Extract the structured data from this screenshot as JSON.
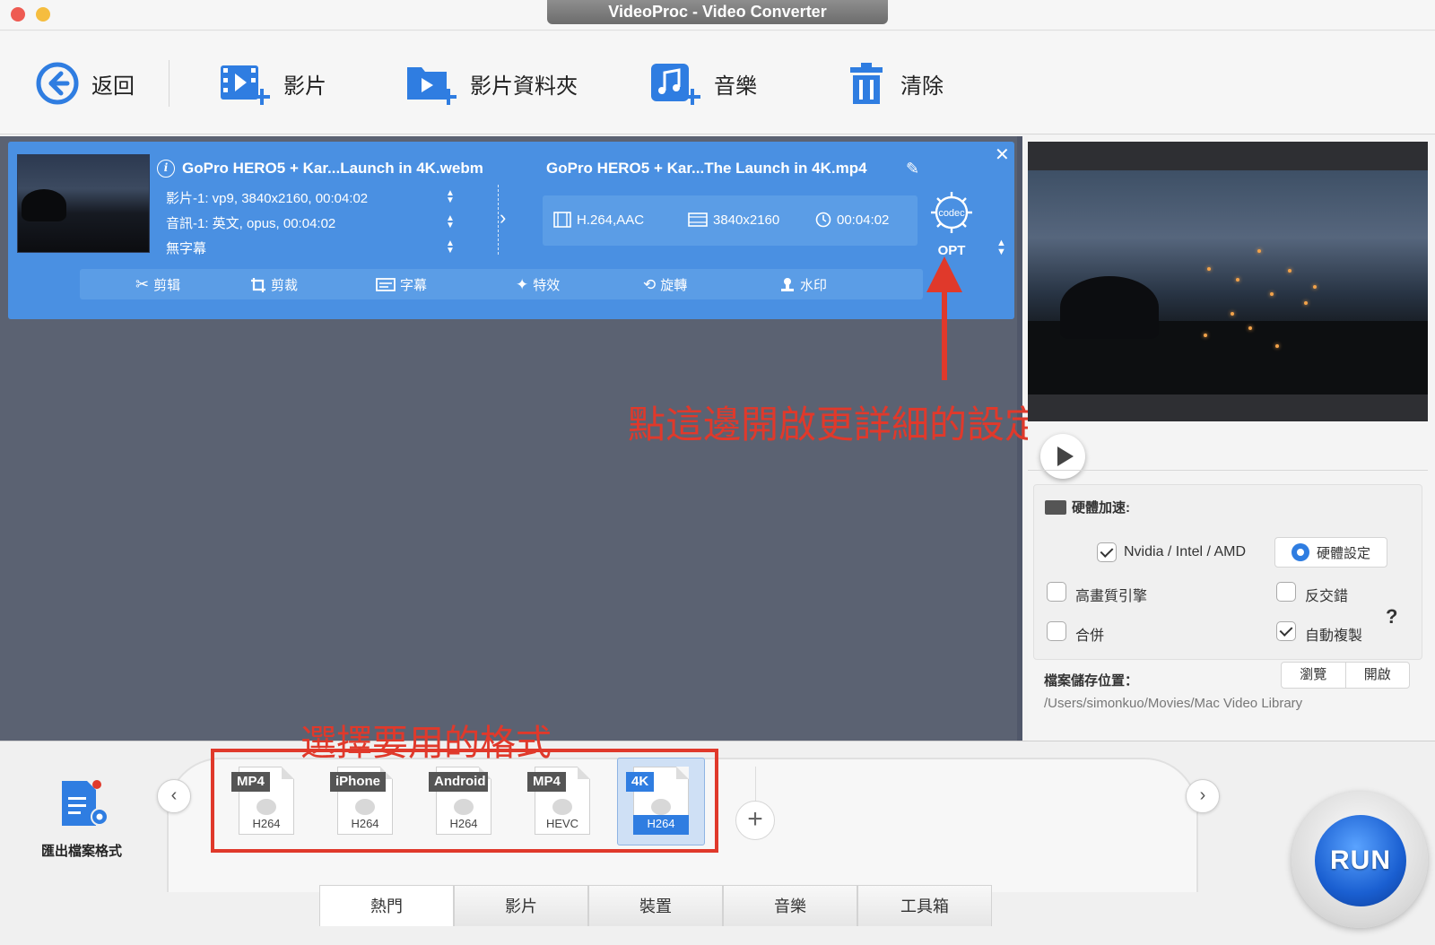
{
  "window": {
    "title": "VideoProc - Video Converter"
  },
  "toolbar": {
    "back": "返回",
    "video": "影片",
    "video_folder": "影片資料夾",
    "music": "音樂",
    "clear": "清除"
  },
  "item": {
    "source_title": "GoPro HERO5 + Kar...Launch in 4K.webm",
    "video_track": "影片-1: vp9, 3840x2160, 00:04:02",
    "audio_track": "音訊-1: 英文, opus, 00:04:02",
    "subtitle_track": "無字幕",
    "output_title": "GoPro HERO5 + Kar...The Launch in 4K.mp4",
    "out_codec": "H.264,AAC",
    "out_resolution": "3840x2160",
    "out_duration": "00:04:02",
    "codec_icon_text": "codec",
    "codec_label": "OPT",
    "edit": {
      "cut": "剪辑",
      "crop": "剪裁",
      "subtitle": "字幕",
      "effects": "特效",
      "rotate": "旋轉",
      "watermark": "水印"
    }
  },
  "annotations": {
    "codec_hint": "點這邊開啟更詳細的設定",
    "format_hint": "選擇要用的格式"
  },
  "settings": {
    "hw_title": "硬體加速:",
    "hw_option": "Nvidia /  Intel / AMD",
    "hw_option_checked": true,
    "hw_button": "硬體設定",
    "high_quality": "高畫質引擎",
    "high_quality_checked": false,
    "deinterlace": "反交錯",
    "deinterlace_checked": false,
    "merge": "合併",
    "merge_checked": false,
    "auto_copy": "自動複製",
    "auto_copy_checked": true,
    "help": "?",
    "save_label": "檔案儲存位置：",
    "browse": "瀏覽",
    "open": "開啟",
    "save_path": "/Users/simonkuo/Movies/Mac Video Library"
  },
  "bottom": {
    "export_label": "匯出檔案格式",
    "formats": [
      {
        "tag": "MP4",
        "codec": "H264",
        "selected": false
      },
      {
        "tag": "iPhone",
        "codec": "H264",
        "selected": false
      },
      {
        "tag": "Android",
        "codec": "H264",
        "selected": false
      },
      {
        "tag": "MP4",
        "codec": "HEVC",
        "selected": false
      },
      {
        "tag": "4K",
        "codec": "H264",
        "selected": true
      }
    ],
    "tabs": [
      "熱門",
      "影片",
      "裝置",
      "音樂",
      "工具箱"
    ],
    "active_tab": "熱門",
    "run": "RUN"
  },
  "colors": {
    "card_blue": "#4a90e2",
    "annotation_red": "#e0392b",
    "accent_blue": "#2f7de1"
  }
}
